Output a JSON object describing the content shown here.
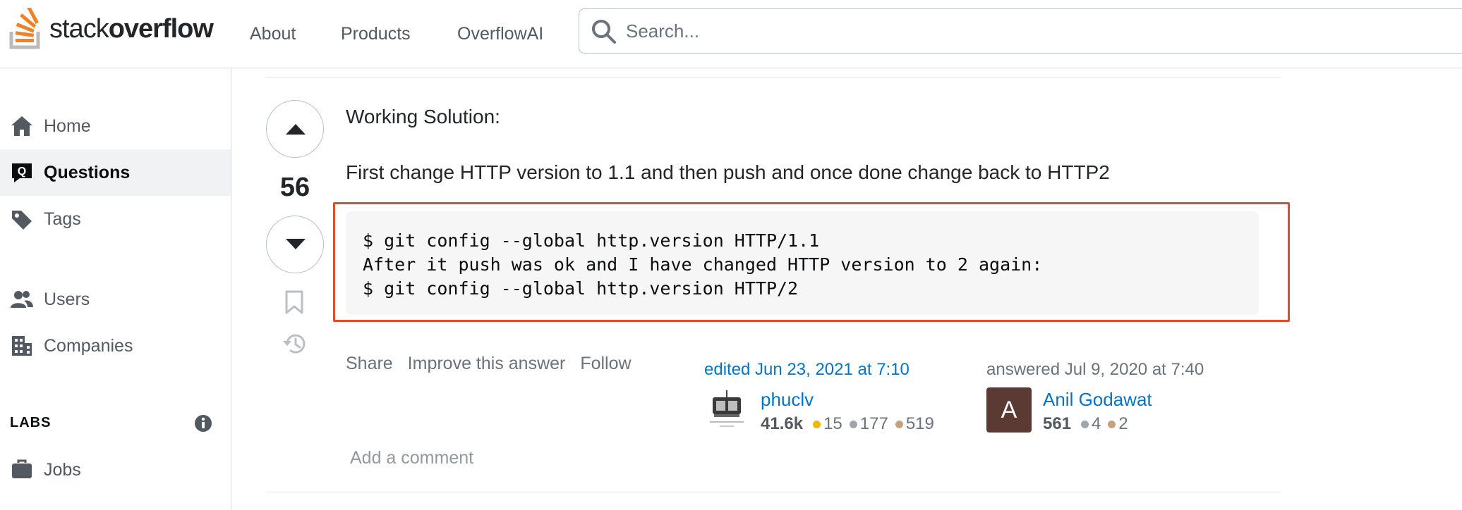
{
  "header": {
    "logo": {
      "text_light": "stack",
      "text_bold": "overflow"
    },
    "nav": [
      {
        "label": "About"
      },
      {
        "label": "Products"
      },
      {
        "label": "OverflowAI"
      }
    ],
    "search": {
      "placeholder": "Search...",
      "value": ""
    }
  },
  "sidebar": {
    "items": [
      {
        "label": "Home",
        "icon": "home-icon",
        "active": false
      },
      {
        "label": "Questions",
        "icon": "questions-icon",
        "active": true
      },
      {
        "label": "Tags",
        "icon": "tag-icon",
        "active": false
      },
      {
        "label": "Users",
        "icon": "users-icon",
        "active": false
      },
      {
        "label": "Companies",
        "icon": "companies-icon",
        "active": false
      }
    ],
    "labs": {
      "title": "LABS",
      "items": [
        {
          "label": "Jobs",
          "icon": "briefcase-icon"
        }
      ]
    }
  },
  "answer": {
    "votes": "56",
    "heading": "Working Solution:",
    "intro": "First change HTTP version to 1.1 and then push and once done change back to HTTP2",
    "code_lines": [
      "$ git config --global http.version HTTP/1.1",
      "After it push was ok and I have changed HTTP version to 2 again:",
      "$ git config --global http.version HTTP/2"
    ],
    "menu": {
      "share": "Share",
      "improve": "Improve this answer",
      "follow": "Follow"
    },
    "editor": {
      "action": "edited Jun 23, 2021 at 7:10",
      "name": "phuclv",
      "reputation": "41.6k",
      "gold": "15",
      "silver": "177",
      "bronze": "519"
    },
    "author": {
      "action": "answered Jul 9, 2020 at 7:40",
      "name": "Anil Godawat",
      "avatar_letter": "A",
      "reputation": "561",
      "silver": "4",
      "bronze": "2"
    },
    "add_comment": "Add a comment"
  },
  "colors": {
    "accent": "#f48024",
    "link": "#0074cc",
    "highlight_border": "#e14b2b",
    "gold": "#f1b600",
    "silver": "#9fa6ad",
    "bronze": "#c8a27c"
  }
}
